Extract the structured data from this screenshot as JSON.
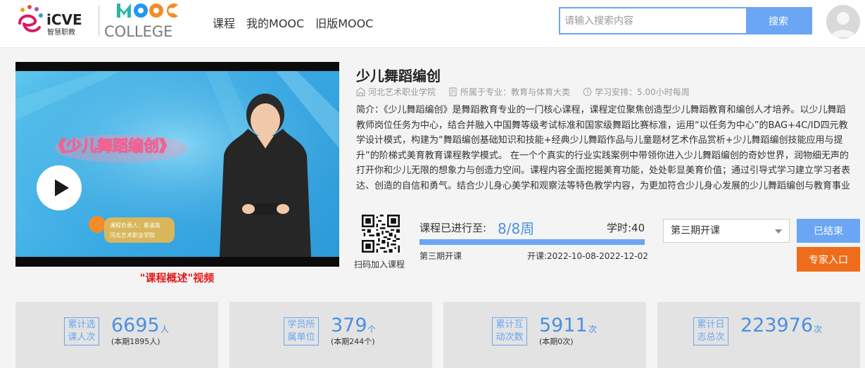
{
  "header": {
    "logo_icve_text": "iCVE",
    "logo_icve_sub": "智慧职教",
    "logo_mooc_text": "MOOC",
    "logo_college_text": "COLLEGE",
    "nav": [
      "课程",
      "我的MOOC",
      "旧版MOOC"
    ],
    "search": {
      "placeholder": "请输入搜索内容",
      "button": "搜索"
    }
  },
  "video": {
    "screen_title": "《少儿舞蹈编创》",
    "badge_line1": "课程负责人：崔淑英",
    "badge_line2": "河北艺术职业学院",
    "caption": "\"课程概述\"视频"
  },
  "course": {
    "title": "少儿舞蹈编创",
    "school": "河北艺术职业学院",
    "major": "所属于专业：教育与体育大类",
    "schedule": "学习安排：5.00小时每周",
    "intro": "简介：《少儿舞蹈编创》是舞蹈教育专业的一门核心课程，课程定位聚焦创造型少儿舞蹈教育和编创人才培养。以少儿舞蹈教师岗位任务为中心，结合并融入中国舞等级考试标准和国家级舞蹈比赛标准，运用“以任务为中心”的BAG+4C/ID四元教学设计模式，构建为“舞蹈编创基础知识和技能+经典少儿舞蹈作品与儿童题材艺术作品赏析+少儿舞蹈编创技能应用与提升”的阶梯式美育教育课程教学模式。 在一个个真实的行业实践案例中带领你进入少儿舞蹈编创的奇妙世界，润物细无声的打开你和少儿无限的想象力与创造力空间。课程内容全面挖掘美育功能，处处彰显美育价值；通过引导式学习建立学习者表达、创造的自信和勇气。结合少儿身心美学和观察法等特色教学内容，为更加符合少儿身心发展的少儿舞蹈编创与教育事业增值赋能，引导学习者站在美育润心的角度掌握少儿舞蹈"
  },
  "progress": {
    "qr_label": "扫码加入课程",
    "label": "课程已进行至:",
    "value": "8/8周",
    "fraction": 1.0,
    "hours": "学时:40",
    "term": "第三期开课",
    "dates": "开课:2022-10-08-2022-12-02"
  },
  "controls": {
    "term_select": "第三期开课",
    "ended_button": "已结束",
    "expert_button": "专家入口"
  },
  "stats": [
    {
      "tag1": "累计选",
      "tag2": "课人次",
      "number": "6695",
      "unit": "人",
      "sub": "(本期1895人)"
    },
    {
      "tag1": "学员所",
      "tag2": "属单位",
      "number": "379",
      "unit": "个",
      "sub": "(本期244个)"
    },
    {
      "tag1": "累计互",
      "tag2": "动次数",
      "number": "5911",
      "unit": "次",
      "sub": "(本期0次)"
    },
    {
      "tag1": "累计日",
      "tag2": "志总次",
      "number": "223976",
      "unit": "次",
      "sub": ""
    }
  ],
  "colors": {
    "accent": "#6aa6f3",
    "number": "#4a90e2",
    "orange": "#ee6c1a",
    "caption_red": "#e31b1b"
  }
}
